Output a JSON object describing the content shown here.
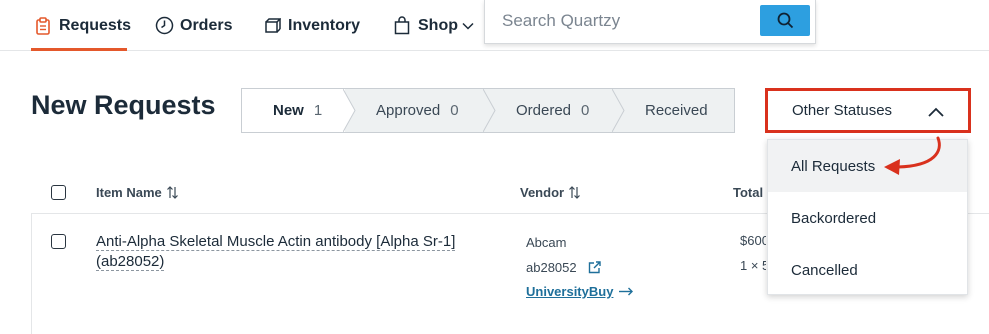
{
  "nav": {
    "items": [
      {
        "label": "Requests",
        "icon": "clipboard-icon",
        "active": true
      },
      {
        "label": "Orders",
        "icon": "clock-icon"
      },
      {
        "label": "Inventory",
        "icon": "box-icon"
      },
      {
        "label": "Shop",
        "icon": "shopping-bag-icon",
        "has_dropdown": true
      }
    ],
    "search": {
      "placeholder": "Search Quartzy"
    },
    "accent_color": "#e4582b",
    "search_button_color": "#2d9fe0"
  },
  "page": {
    "title": "New Requests"
  },
  "status_tabs": [
    {
      "label": "New",
      "count": "1"
    },
    {
      "label": "Approved",
      "count": "0"
    },
    {
      "label": "Ordered",
      "count": "0"
    },
    {
      "label": "Received",
      "count": ""
    }
  ],
  "other_statuses": {
    "label": "Other Statuses",
    "highlight_color": "#d9311d",
    "options": [
      {
        "label": "All Requests",
        "highlighted": true
      },
      {
        "label": "Backordered"
      },
      {
        "label": "Cancelled"
      }
    ]
  },
  "table": {
    "columns": {
      "item_name": "Item Name",
      "vendor": "Vendor",
      "total": "Total"
    },
    "rows": [
      {
        "item_name": "Anti-Alpha Skeletal Muscle Actin antibody [Alpha Sr-1] (ab28052)",
        "item_name_line1": "Anti-Alpha Skeletal Muscle Actin antibody [Alpha Sr-1]",
        "item_name_line2": "(ab28052)",
        "vendor": "Abcam",
        "catalog": "ab28052",
        "buy_link": "UniversityBuy",
        "price": "$600",
        "quantity": "1 × 5"
      }
    ]
  }
}
